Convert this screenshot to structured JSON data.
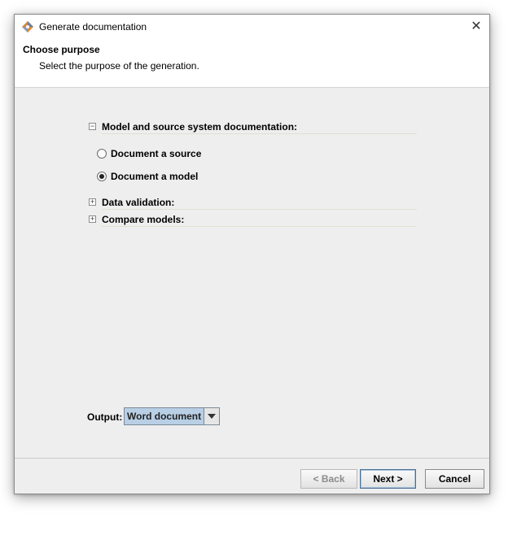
{
  "window": {
    "title": "Generate documentation",
    "close_glyph": "✕"
  },
  "header": {
    "title": "Choose purpose",
    "subtitle": "Select the purpose of the generation."
  },
  "sections": [
    {
      "label": "Model and source system documentation:",
      "expander": "−",
      "expanded": true,
      "options": [
        {
          "label": "Document a source",
          "selected": false
        },
        {
          "label": "Document a model",
          "selected": true
        }
      ]
    },
    {
      "label": "Data validation:",
      "expander": "+",
      "expanded": false
    },
    {
      "label": "Compare models:",
      "expander": "+",
      "expanded": false
    }
  ],
  "output": {
    "label": "Output:",
    "value": "Word document"
  },
  "buttons": {
    "back": "< Back",
    "next": "Next >",
    "cancel": "Cancel"
  },
  "colors": {
    "combo_selected_bg": "#b8cfe5",
    "dialog_bg": "#eeeeee"
  }
}
